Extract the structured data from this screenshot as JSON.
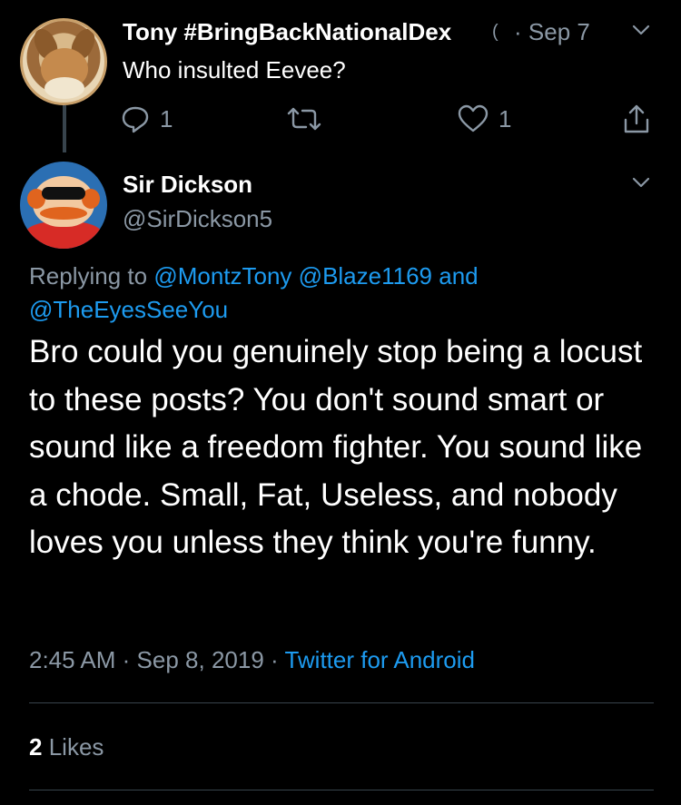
{
  "parent": {
    "name": "Tony #BringBackNationalDex",
    "verified_glyph": "(",
    "separator": "·",
    "date": "Sep 7",
    "text": "Who insulted Eevee?",
    "reply_count": "1",
    "like_count": "1"
  },
  "main": {
    "name": "Sir Dickson",
    "handle": "@SirDickson5",
    "replying_prefix": "Replying to",
    "mention1": "@MontzTony",
    "mention2": "@Blaze1169",
    "and": "and",
    "mention3": "@TheEyesSeeYou",
    "text": "Bro could you genuinely stop being a locust to these posts? You don't sound smart or sound like a freedom fighter. You sound like a chode. Small, Fat, Useless, and nobody loves you unless they think you're funny.",
    "time": "2:45 AM",
    "dot": "·",
    "date": "Sep 8, 2019",
    "dot2": "·",
    "source": "Twitter for Android",
    "likes_count": "2",
    "likes_label": "Likes"
  },
  "icons": {
    "reply": "reply-icon",
    "retweet": "retweet-icon",
    "like": "heart-icon",
    "share": "share-icon",
    "more": "chevron-down-icon"
  },
  "colors": {
    "background": "#000000",
    "text": "#ffffff",
    "muted": "#8b98a5",
    "link": "#1d9bf0",
    "divider": "#38444d"
  }
}
